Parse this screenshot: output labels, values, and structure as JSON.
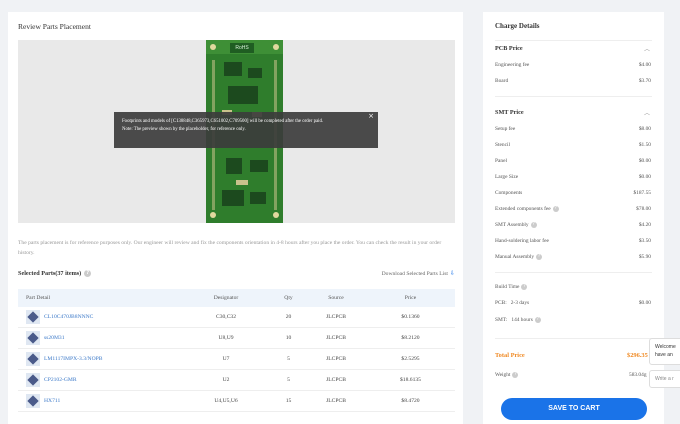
{
  "review": {
    "title": "Review Parts Placement",
    "pcb_badge": "RoHS",
    "tooltip_line1": "Footprints and models of [C138848,C365973,C651002,C709500] will be completed after the order paid.",
    "tooltip_line2": "Note: The preview shown by the placeholder, for reference only.",
    "note": "The parts placement is for reference purposes only. Our engineer will review and fix the components orientation in 4-8 hours after you place the order. You can check the result in your order history."
  },
  "parts": {
    "title": "Selected Parts(37 items)",
    "download_label": "Download Selected Parts List",
    "columns": [
      "Part Detail",
      "Designator",
      "Qty",
      "Source",
      "Price"
    ],
    "rows": [
      {
        "part": "CL10C470JB8NNNC",
        "designator": "C30,C32",
        "qty": "20",
        "source": "JLCPCB",
        "price": "$0.1360"
      },
      {
        "part": "ss20M31",
        "designator": "U8,U9",
        "qty": "10",
        "source": "JLCPCB",
        "price": "$8.2120"
      },
      {
        "part": "LM1117IMPX-3.3/NOPB",
        "designator": "U7",
        "qty": "5",
        "source": "JLCPCB",
        "price": "$2.5295"
      },
      {
        "part": "CP2102-GMR",
        "designator": "U2",
        "qty": "5",
        "source": "JLCPCB",
        "price": "$18.6135"
      },
      {
        "part": "HX711",
        "designator": "U4,U5,U6",
        "qty": "15",
        "source": "JLCPCB",
        "price": "$8.4720"
      }
    ]
  },
  "charges": {
    "title": "Charge Details",
    "pcb": {
      "title": "PCB Price",
      "items": [
        {
          "label": "Engineering fee",
          "value": "$4.00"
        },
        {
          "label": "Board",
          "value": "$3.70"
        }
      ]
    },
    "smt": {
      "title": "SMT Price",
      "items": [
        {
          "label": "Setup fee",
          "value": "$8.00"
        },
        {
          "label": "Stencil",
          "value": "$1.50"
        },
        {
          "label": "Panel",
          "value": "$0.00"
        },
        {
          "label": "Large Size",
          "value": "$0.00"
        },
        {
          "label": "Components",
          "value": "$187.55"
        },
        {
          "label": "Extended components fee",
          "value": "$78.00"
        },
        {
          "label": "SMT Assembly",
          "value": "$4.20"
        },
        {
          "label": "Hand-soldering labor fee",
          "value": "$3.50"
        },
        {
          "label": "Manual Assembly",
          "value": "$5.90"
        }
      ]
    },
    "build_time": {
      "title": "Build Time",
      "pcb_label": "PCB:",
      "pcb_days": "2-3 days",
      "pcb_value": "$0.00",
      "smt_label": "SMT:",
      "smt_hours": "144 hours"
    },
    "total_label": "Total Price",
    "total_value": "$296.35",
    "weight_label": "Weight",
    "weight_value": "583.04g"
  },
  "cart_button": "SAVE TO CART",
  "chat": {
    "popup_line1": "Welcome",
    "popup_line2": "have an",
    "input_placeholder": "Write a r"
  },
  "colors": {
    "accent": "#1a73e8",
    "total": "#f08a24",
    "pcb_green": "#2f7d2c"
  }
}
